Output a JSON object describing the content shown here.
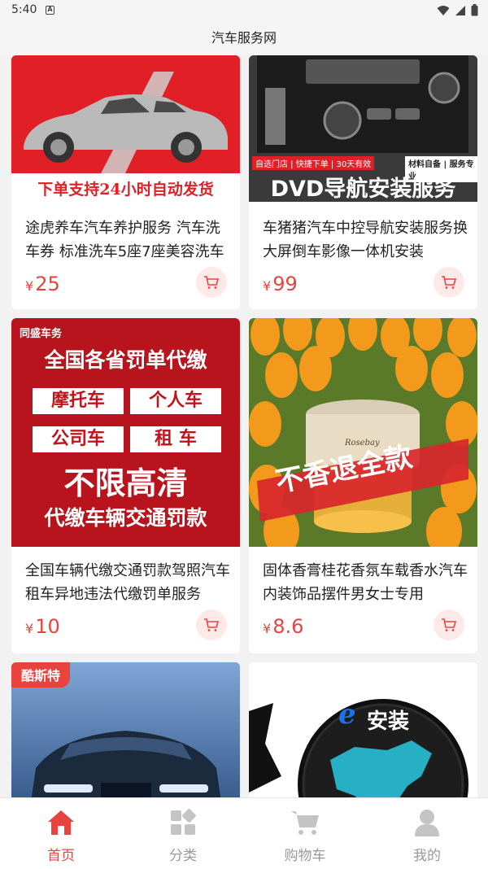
{
  "status": {
    "time": "5:40",
    "notif_glyph": "A"
  },
  "header": {
    "title": "汽车服务网"
  },
  "products": [
    {
      "title": "途虎养车汽车养护服务 汽车洗车券 标准洗车5座7座美容洗车",
      "price": "25",
      "image_text": {
        "banner": "下单支持24小时自动发货"
      }
    },
    {
      "title": "车猪猪汽车中控导航安装服务换大屏倒车影像一体机安装",
      "price": "99",
      "image_text": {
        "tag_left": "自选门店 | 快捷下单 | 30天有效",
        "tag_right": "材料自备 | 服务专业",
        "banner": "DVD导航安装服务"
      }
    },
    {
      "title": "全国车辆代缴交通罚款驾照汽车租车异地违法代缴罚单服务",
      "price": "10",
      "image_text": {
        "brand": "同盛车务",
        "line1": "全国各省罚单代缴",
        "box1": "摩托车",
        "box2": "个人车",
        "box3": "公司车",
        "box4": "租  车",
        "line2": "不限高清",
        "line3": "代缴车辆交通罚款"
      }
    },
    {
      "title": "固体香膏桂花香氛车载香水汽车内装饰品摆件男女士专用",
      "price": "8.6",
      "image_text": {
        "banner": "不香退全款",
        "lid": "Rosebay"
      }
    },
    {
      "title": "",
      "price": "",
      "image_text": {
        "brand": "酷斯特"
      }
    },
    {
      "title": "",
      "price": "",
      "image_text": {
        "e": "e",
        "label": "安装"
      }
    }
  ],
  "currency": "¥",
  "nav": [
    {
      "label": "首页",
      "icon": "home-icon",
      "active": true
    },
    {
      "label": "分类",
      "icon": "category-icon",
      "active": false
    },
    {
      "label": "购物车",
      "icon": "cart-icon",
      "active": false
    },
    {
      "label": "我的",
      "icon": "user-icon",
      "active": false
    }
  ],
  "colors": {
    "accent": "#e8443f",
    "inactive": "#c4c4c4"
  }
}
